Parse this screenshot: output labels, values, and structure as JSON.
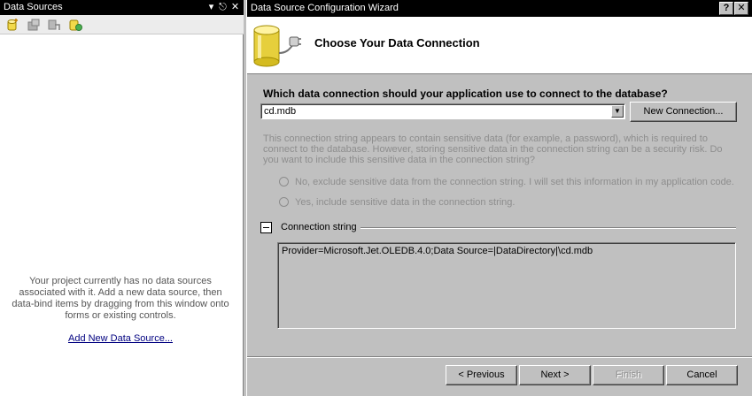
{
  "data_sources": {
    "title": "Data Sources",
    "pin_glyph": "−⬇",
    "close_glyph": "✕",
    "toolbar_icons": [
      "add-data-source-icon",
      "edit-dataset-icon",
      "configure-dataset-icon",
      "refresh-icon"
    ],
    "empty_message": "Your project currently has no data sources associated with it. Add a new data source, then data-bind items by dragging from this window onto forms or existing controls.",
    "add_link": "Add New Data Source..."
  },
  "wizard": {
    "title": "Data Source Configuration Wizard",
    "help_glyph": "?",
    "close_glyph": "✕",
    "header_title": "Choose Your Data Connection",
    "question": "Which data connection should your application use to connect to the database?",
    "connection_value": "cd.mdb",
    "new_connection_label": "New Connection...",
    "sensitive_text": "This connection string appears to contain sensitive data (for example, a password), which is required to connect to the database. However, storing sensitive data in the connection string can be a security risk. Do you want to include this sensitive data in the connection string?",
    "radio_no": "No, exclude sensitive data from the connection string. I will set this information in my application code.",
    "radio_yes": "Yes, include sensitive data in the connection string.",
    "connection_string_label": "Connection string",
    "connection_string": "Provider=Microsoft.Jet.OLEDB.4.0;Data Source=|DataDirectory|\\cd.mdb",
    "buttons": {
      "previous": "< Previous",
      "next": "Next >",
      "finish": "Finish",
      "cancel": "Cancel"
    }
  },
  "colors": {
    "title_bar": "#000000",
    "dialog_face": "#c0c0c0",
    "disabled_text": "#8d8d8d",
    "link": "#000080"
  }
}
